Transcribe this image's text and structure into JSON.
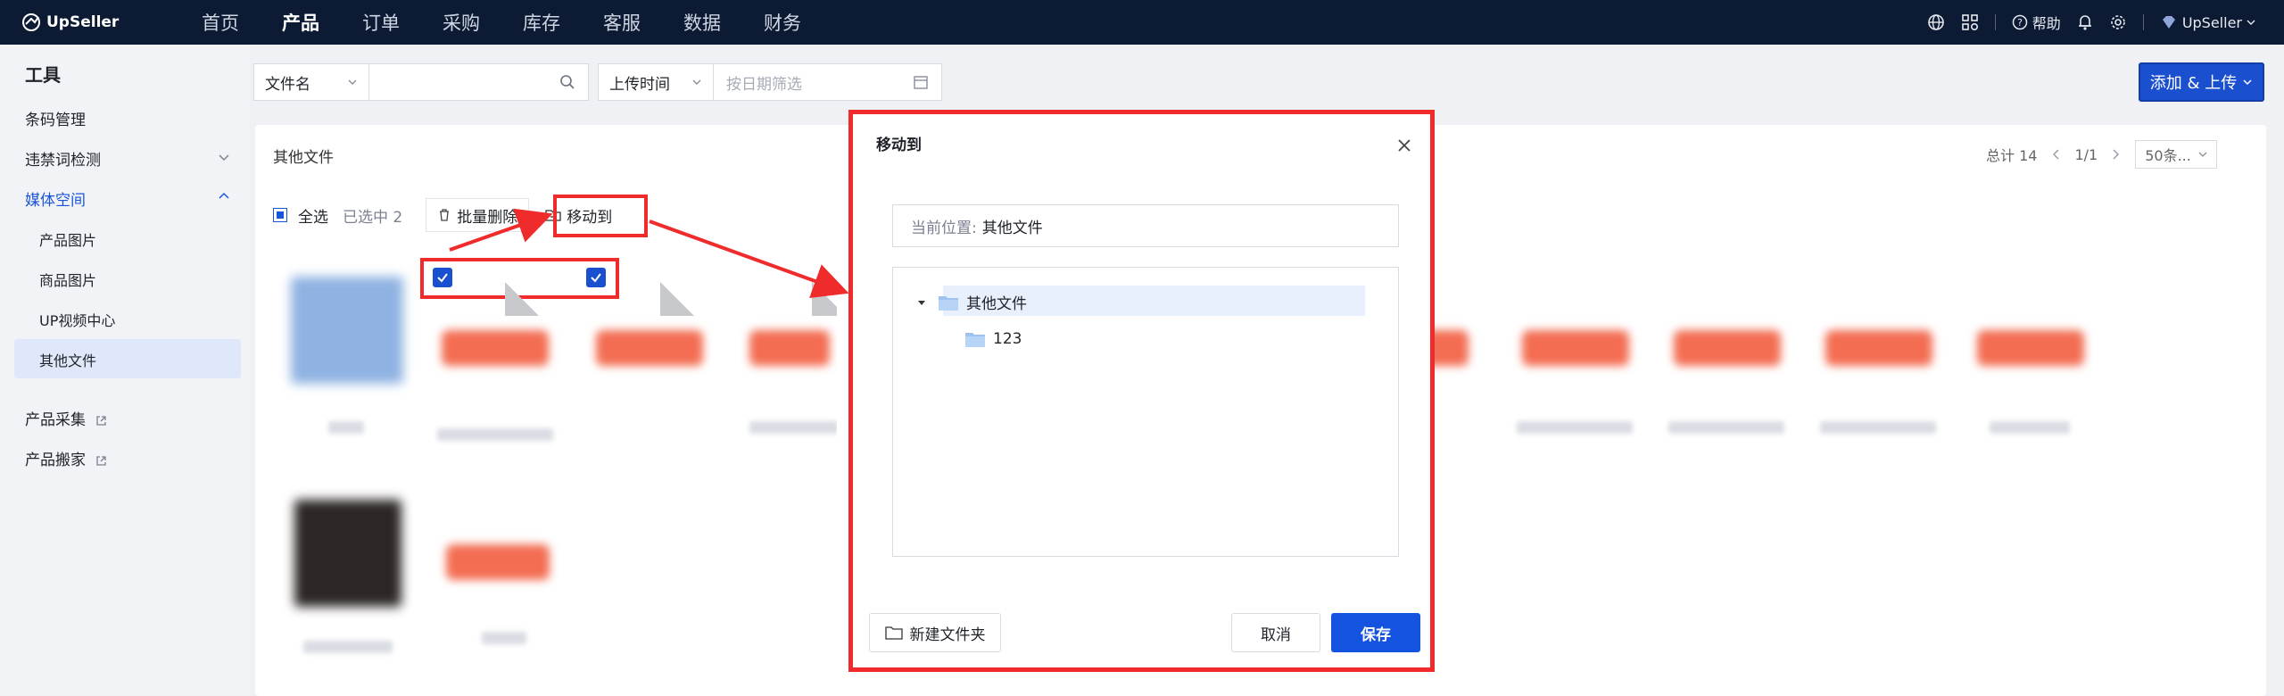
{
  "brand": {
    "name": "UpSeller"
  },
  "nav": {
    "items": [
      "首页",
      "产品",
      "订单",
      "采购",
      "库存",
      "客服",
      "数据",
      "财务"
    ],
    "active_index": 1
  },
  "topright": {
    "help": "帮助",
    "account": "UpSeller"
  },
  "sidebar": {
    "title": "工具",
    "items": {
      "barcode": "条码管理",
      "banned_words": "违禁词检测",
      "media": "媒体空间",
      "product_images": "产品图片",
      "goods_images": "商品图片",
      "up_video": "UP视频中心",
      "other_files": "其他文件",
      "product_collect": "产品采集",
      "product_move": "产品搬家"
    }
  },
  "filters": {
    "field_select": "文件名",
    "search_placeholder": "",
    "date_type": "上传时间",
    "date_placeholder": "按日期筛选"
  },
  "add_button": "添加 & 上传",
  "content": {
    "breadcrumb": "其他文件",
    "pager": {
      "total": "总计 14",
      "pages": "1/1",
      "page_size": "50条..."
    },
    "toolbar": {
      "select_all": "全选",
      "selected": "已选中 2",
      "batch_delete": "批量删除",
      "move_to": "移动到"
    }
  },
  "dialog": {
    "title": "移动到",
    "location_label": "当前位置:",
    "location_value": "其他文件",
    "tree": {
      "root": "其他文件",
      "child": "123"
    },
    "new_folder": "新建文件夹",
    "cancel": "取消",
    "save": "保存"
  },
  "colors": {
    "topbar": "#0c1a33",
    "primary": "#1a4fcf",
    "annotation": "#ef2b2b"
  }
}
